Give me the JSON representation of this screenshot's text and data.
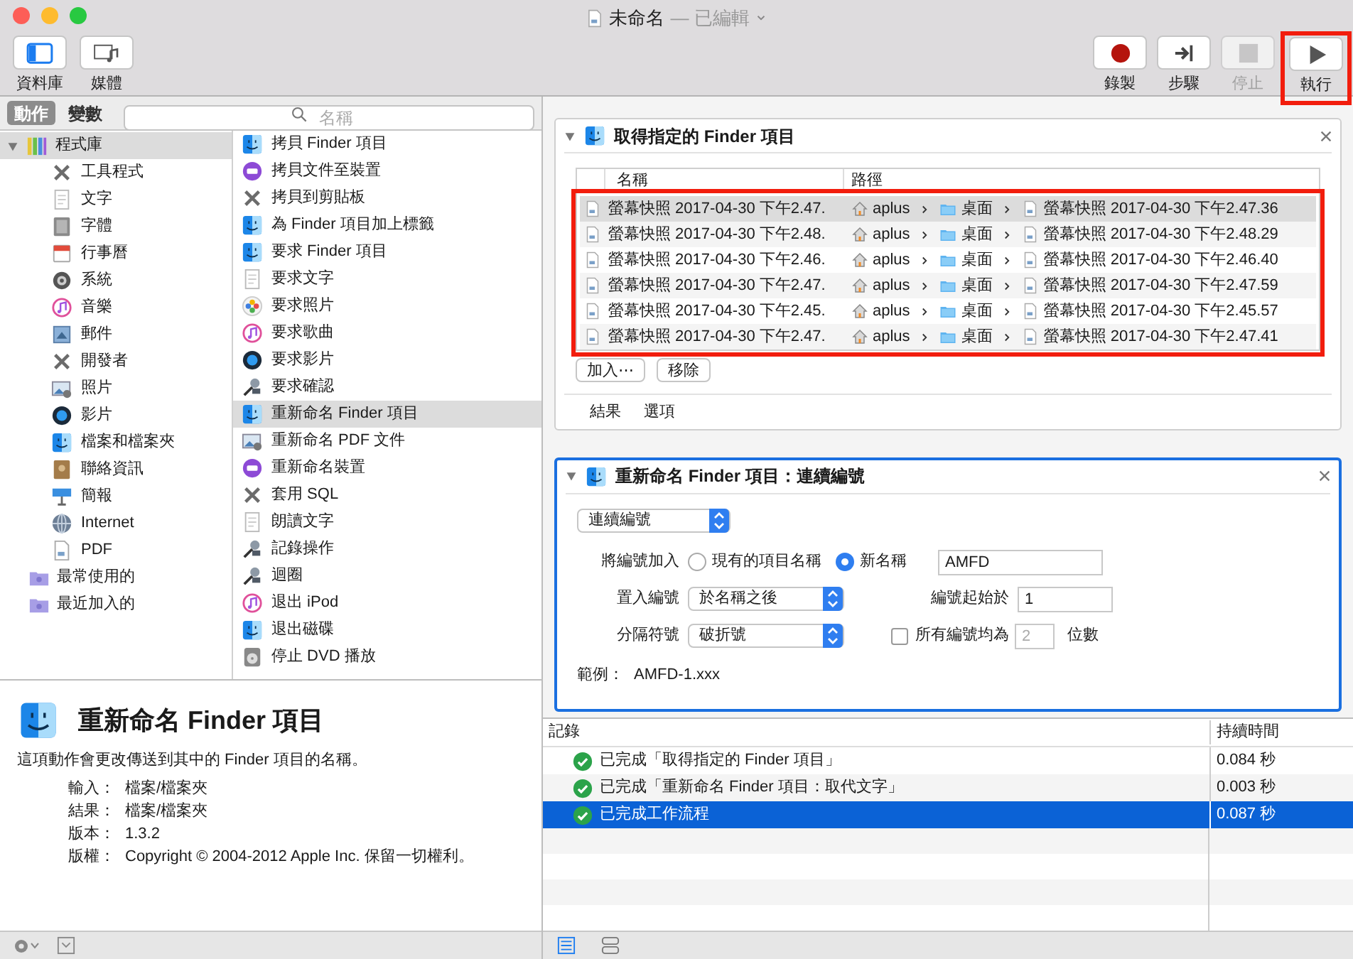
{
  "window": {
    "title": "未命名",
    "subtitle": "— 已編輯"
  },
  "toolbar": {
    "left": [
      {
        "label": "資料庫"
      },
      {
        "label": "媒體"
      }
    ],
    "right": [
      {
        "label": "錄製",
        "disabled": false,
        "highlighted": false
      },
      {
        "label": "步驟",
        "disabled": false,
        "highlighted": false
      },
      {
        "label": "停止",
        "disabled": true,
        "highlighted": false
      },
      {
        "label": "執行",
        "disabled": false,
        "highlighted": true
      }
    ]
  },
  "tabs": [
    {
      "label": "動作",
      "selected": true
    },
    {
      "label": "變數",
      "selected": false
    }
  ],
  "search": {
    "placeholder": "名稱"
  },
  "library": [
    {
      "label": "程式庫",
      "selected": true,
      "expanded": true,
      "children": [
        {
          "label": "工具程式",
          "selected": false
        },
        {
          "label": "文字",
          "selected": false
        },
        {
          "label": "字體",
          "selected": false
        },
        {
          "label": "行事曆",
          "selected": false
        },
        {
          "label": "系統",
          "selected": false
        },
        {
          "label": "音樂",
          "selected": false
        },
        {
          "label": "郵件",
          "selected": false
        },
        {
          "label": "開發者",
          "selected": false
        },
        {
          "label": "照片",
          "selected": false
        },
        {
          "label": "影片",
          "selected": false
        },
        {
          "label": "檔案和檔案夾",
          "selected": false
        },
        {
          "label": "聯絡資訊",
          "selected": false
        },
        {
          "label": "簡報",
          "selected": false
        },
        {
          "label": "Internet",
          "selected": false
        },
        {
          "label": "PDF",
          "selected": false
        }
      ]
    },
    {
      "label": "最常使用的",
      "selected": false
    },
    {
      "label": "最近加入的",
      "selected": false
    }
  ],
  "actions": [
    {
      "label": "拷貝 Finder 項目",
      "selected": false
    },
    {
      "label": "拷貝文件至裝置",
      "selected": false
    },
    {
      "label": "拷貝到剪貼板",
      "selected": false
    },
    {
      "label": "為 Finder 項目加上標籤",
      "selected": false
    },
    {
      "label": "要求 Finder 項目",
      "selected": false
    },
    {
      "label": "要求文字",
      "selected": false
    },
    {
      "label": "要求照片",
      "selected": false
    },
    {
      "label": "要求歌曲",
      "selected": false
    },
    {
      "label": "要求影片",
      "selected": false
    },
    {
      "label": "要求確認",
      "selected": false
    },
    {
      "label": "重新命名 Finder 項目",
      "selected": true
    },
    {
      "label": "重新命名 PDF 文件",
      "selected": false
    },
    {
      "label": "重新命名裝置",
      "selected": false
    },
    {
      "label": "套用 SQL",
      "selected": false
    },
    {
      "label": "朗讀文字",
      "selected": false
    },
    {
      "label": "記錄操作",
      "selected": false
    },
    {
      "label": "迴圈",
      "selected": false
    },
    {
      "label": "退出 iPod",
      "selected": false
    },
    {
      "label": "退出磁碟",
      "selected": false
    },
    {
      "label": "停止 DVD 播放",
      "selected": false
    }
  ],
  "description": {
    "title": "重新命名 Finder 項目",
    "text": "這項動作會更改傳送到其中的 Finder 項目的名稱。",
    "fields": [
      {
        "label": "輸入：",
        "value": "檔案/檔案夾"
      },
      {
        "label": "結果：",
        "value": "檔案/檔案夾"
      },
      {
        "label": "版本：",
        "value": "1.3.2"
      },
      {
        "label": "版權：",
        "value": "Copyright © 2004-2012 Apple Inc. 保留一切權利。"
      }
    ]
  },
  "workflow": [
    {
      "title": "取得指定的 Finder 項目",
      "selected": false,
      "table": {
        "columns": [
          "名稱",
          "路徑"
        ],
        "highlighted": true,
        "rows": [
          {
            "name": "螢幕快照 2017-04-30 下午2.47.",
            "path": [
              "aplus",
              "桌面",
              "螢幕快照 2017-04-30 下午2.47.36"
            ],
            "selected": true
          },
          {
            "name": "螢幕快照 2017-04-30 下午2.48.",
            "path": [
              "aplus",
              "桌面",
              "螢幕快照 2017-04-30 下午2.48.29"
            ],
            "selected": false
          },
          {
            "name": "螢幕快照 2017-04-30 下午2.46.",
            "path": [
              "aplus",
              "桌面",
              "螢幕快照 2017-04-30 下午2.46.40"
            ],
            "selected": false
          },
          {
            "name": "螢幕快照 2017-04-30 下午2.47.",
            "path": [
              "aplus",
              "桌面",
              "螢幕快照 2017-04-30 下午2.47.59"
            ],
            "selected": false
          },
          {
            "name": "螢幕快照 2017-04-30 下午2.45.",
            "path": [
              "aplus",
              "桌面",
              "螢幕快照 2017-04-30 下午2.45.57"
            ],
            "selected": false
          },
          {
            "name": "螢幕快照 2017-04-30 下午2.47.",
            "path": [
              "aplus",
              "桌面",
              "螢幕快照 2017-04-30 下午2.47.41"
            ],
            "selected": false
          }
        ]
      },
      "buttons": [
        "加入⋯",
        "移除"
      ],
      "footer_tabs": [
        "結果",
        "選項"
      ]
    },
    {
      "title": "重新命名 Finder 項目：連續編號",
      "selected": true,
      "mode": "連續編號",
      "add_number_to": {
        "label": "將編號加入",
        "options": [
          {
            "label": "現有的項目名稱",
            "selected": false
          },
          {
            "label": "新名稱",
            "selected": true
          }
        ],
        "value": "AMFD"
      },
      "place_number": {
        "label": "置入編號",
        "value": "於名稱之後"
      },
      "start_at": {
        "label": "編號起始於",
        "value": "1"
      },
      "separator": {
        "label": "分隔符號",
        "value": "破折號"
      },
      "digits": {
        "label": "所有編號均為",
        "checked": false,
        "value": "2",
        "unit": "位數"
      },
      "example": {
        "label": "範例：",
        "value": "AMFD-1.xxx"
      }
    }
  ],
  "log": {
    "columns": [
      "記錄",
      "持續時間"
    ],
    "rows": [
      {
        "text": "已完成「取得指定的 Finder 項目」",
        "duration": "0.084 秒",
        "selected": false
      },
      {
        "text": "已完成「重新命名 Finder 項目：取代文字」",
        "duration": "0.003 秒",
        "selected": false
      },
      {
        "text": "已完成工作流程",
        "duration": "0.087 秒",
        "selected": true
      }
    ]
  }
}
